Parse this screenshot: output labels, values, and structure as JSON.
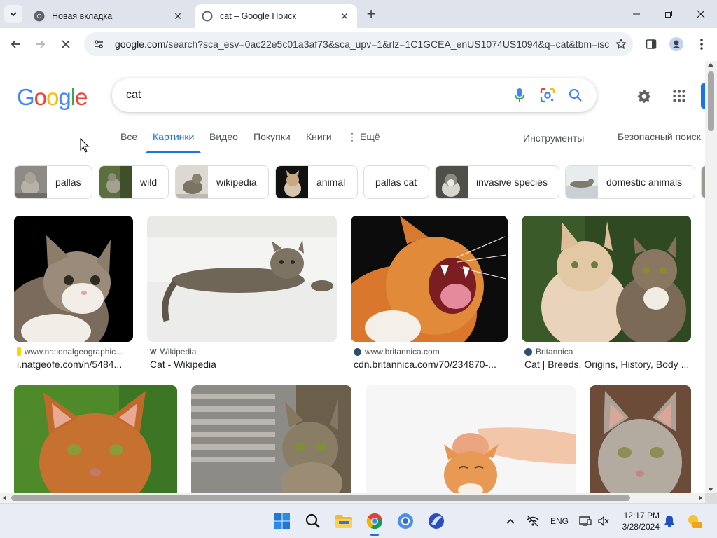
{
  "browser": {
    "tabs": [
      {
        "title": "Новая вкладка",
        "active": false
      },
      {
        "title": "cat – Google Поиск",
        "active": true
      }
    ],
    "url_host": "google.com",
    "url_rest": "/search?sca_esv=0ac22e5c01a3af73&sca_upv=1&rlz=1C1GCEA_enUS1074US1094&q=cat&tbm=isch..."
  },
  "search": {
    "logo": [
      "G",
      "o",
      "o",
      "g",
      "l",
      "e"
    ],
    "query": "cat"
  },
  "nav": {
    "tabs": [
      "Все",
      "Картинки",
      "Видео",
      "Покупки",
      "Книги",
      "Ещё"
    ],
    "active_index": 1,
    "tools": "Инструменты",
    "safesearch": "Безопасный поиск"
  },
  "chips": [
    {
      "label": "pallas",
      "has_thumb": true
    },
    {
      "label": "wild",
      "has_thumb": true
    },
    {
      "label": "wikipedia",
      "has_thumb": true
    },
    {
      "label": "animal",
      "has_thumb": true
    },
    {
      "label": "pallas cat",
      "has_thumb": false
    },
    {
      "label": "invasive species",
      "has_thumb": true
    },
    {
      "label": "domestic animals",
      "has_thumb": true
    }
  ],
  "results": [
    {
      "source": "www.nationalgeographic...",
      "title": "i.natgeofe.com/n/5484..."
    },
    {
      "source": "Wikipedia",
      "title": "Cat - Wikipedia"
    },
    {
      "source": "www.britannica.com",
      "title": "cdn.britannica.com/70/234870-..."
    },
    {
      "source": "Britannica",
      "title": "Cat | Breeds, Origins, History, Body ..."
    },
    {
      "source": "",
      "title": ""
    },
    {
      "source": "",
      "title": ""
    },
    {
      "source": "",
      "title": ""
    },
    {
      "source": "",
      "title": ""
    }
  ],
  "taskbar": {
    "lang": "ENG",
    "time": "12:17 PM",
    "date": "3/28/2024"
  },
  "colors": {
    "accent": "#1a73e8",
    "logo_blue": "#4285f4",
    "logo_red": "#ea4335",
    "logo_yellow": "#fbbc05",
    "logo_green": "#34a853"
  }
}
